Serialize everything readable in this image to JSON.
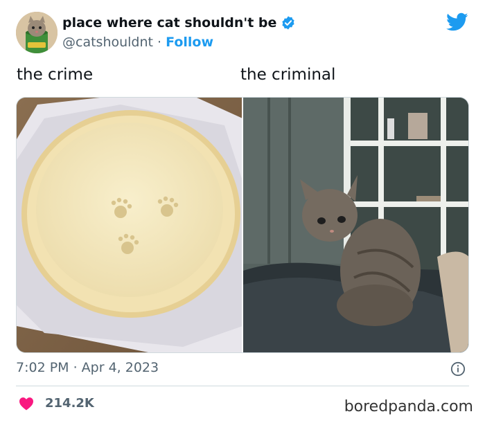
{
  "tweet": {
    "display_name": "place where cat shouldn't be",
    "handle": "@catshouldnt",
    "separator": "·",
    "follow_label": "Follow",
    "caption_left": "the crime",
    "caption_right": "the criminal",
    "timestamp": "7:02 PM · Apr 4, 2023",
    "like_count": "214.2K"
  },
  "media": {
    "left_photo": "pie-crust-with-paw-prints",
    "right_photo": "tabby-kitten-on-couch"
  },
  "icons": {
    "verified": "verified-badge-icon",
    "twitter": "twitter-bird-icon",
    "info": "info-icon",
    "like": "heart-icon"
  },
  "watermark": "boredpanda.com",
  "colors": {
    "accent": "#1d9bf0",
    "like": "#f91880",
    "secondary_text": "#536471"
  }
}
